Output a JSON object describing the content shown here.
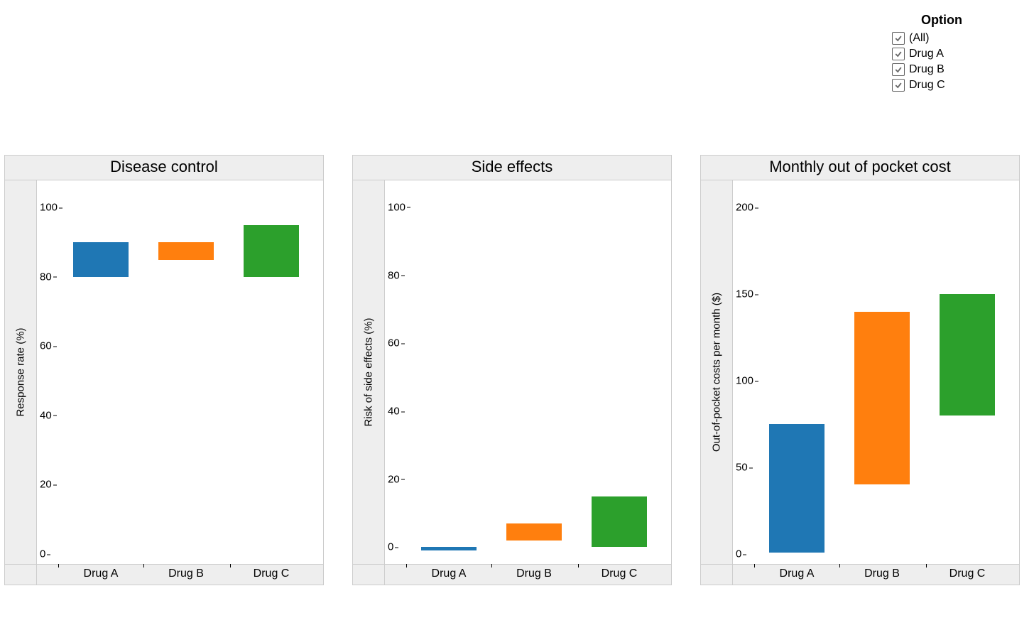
{
  "legend": {
    "title": "Option",
    "items": [
      {
        "label": "(All)",
        "checked": true
      },
      {
        "label": "Drug A",
        "checked": true
      },
      {
        "label": "Drug B",
        "checked": true
      },
      {
        "label": "Drug C",
        "checked": true
      }
    ]
  },
  "colors": {
    "DrugA": "#1f77b4",
    "DrugB": "#ff7f0e",
    "DrugC": "#2ca02c"
  },
  "chart_data": [
    {
      "type": "bar",
      "title": "Disease control",
      "ylabel": "Response rate (%)",
      "xlabel": "",
      "ylim": [
        0,
        105
      ],
      "yticks": [
        0,
        20,
        40,
        60,
        80,
        100
      ],
      "categories": [
        "Drug A",
        "Drug B",
        "Drug C"
      ],
      "series": [
        {
          "name": "range",
          "low": [
            80,
            85,
            80
          ],
          "high": [
            90,
            90,
            95
          ]
        }
      ]
    },
    {
      "type": "bar",
      "title": "Side effects",
      "ylabel": "Risk of side effects (%)",
      "xlabel": "",
      "ylim": [
        -2,
        105
      ],
      "yticks": [
        0,
        20,
        40,
        60,
        80,
        100
      ],
      "categories": [
        "Drug A",
        "Drug B",
        "Drug C"
      ],
      "series": [
        {
          "name": "range",
          "low": [
            -1,
            2,
            0
          ],
          "high": [
            0,
            7,
            15
          ]
        }
      ]
    },
    {
      "type": "bar",
      "title": "Monthly out of pocket cost",
      "ylabel": "Out-of-pocket costs per month ($)",
      "xlabel": "",
      "ylim": [
        0,
        210
      ],
      "yticks": [
        0,
        50,
        100,
        150,
        200
      ],
      "categories": [
        "Drug A",
        "Drug B",
        "Drug C"
      ],
      "series": [
        {
          "name": "range",
          "low": [
            1,
            40,
            80
          ],
          "high": [
            75,
            140,
            150
          ]
        }
      ]
    }
  ]
}
